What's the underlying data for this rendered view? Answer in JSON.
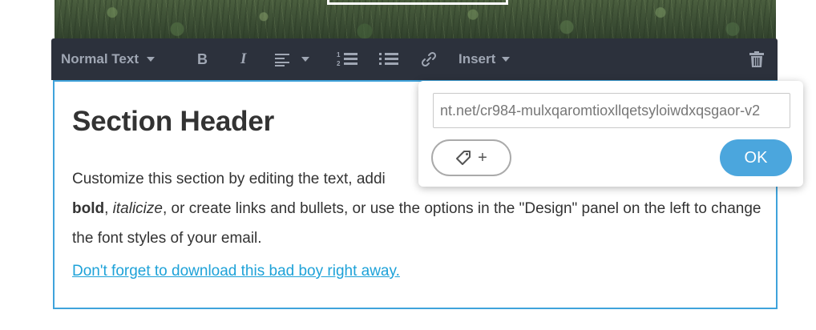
{
  "toolbar": {
    "text_style": "Normal Text",
    "bold_label": "B",
    "italic_label": "I",
    "insert_label": "Insert",
    "icons": [
      "bold-icon",
      "italic-icon",
      "align-icon",
      "numbered-list-icon",
      "bulleted-list-icon",
      "link-icon",
      "trash-icon"
    ]
  },
  "section": {
    "title": "Section Header",
    "para_1": "Customize this section by editing the text, addi",
    "para_bold": "bold",
    "para_2": ", ",
    "para_italic": "italicize",
    "para_3": ", or create links and bullets, or use the options in the \"Design\" panel on the left to change the font styles of your email.",
    "link_text": "Don't forget to download this bad boy right away."
  },
  "link_popup": {
    "url_value": "nt.net/cr984-mulxqaromtioxllqetsyloiwdxqsgaor-v2",
    "tag_plus": "+",
    "ok_label": "OK"
  },
  "colors": {
    "toolbar_bg": "#2c313c",
    "accent_blue": "#3fa3db",
    "ok_blue": "#4ba6dd",
    "link_blue": "#1ea2d8"
  }
}
